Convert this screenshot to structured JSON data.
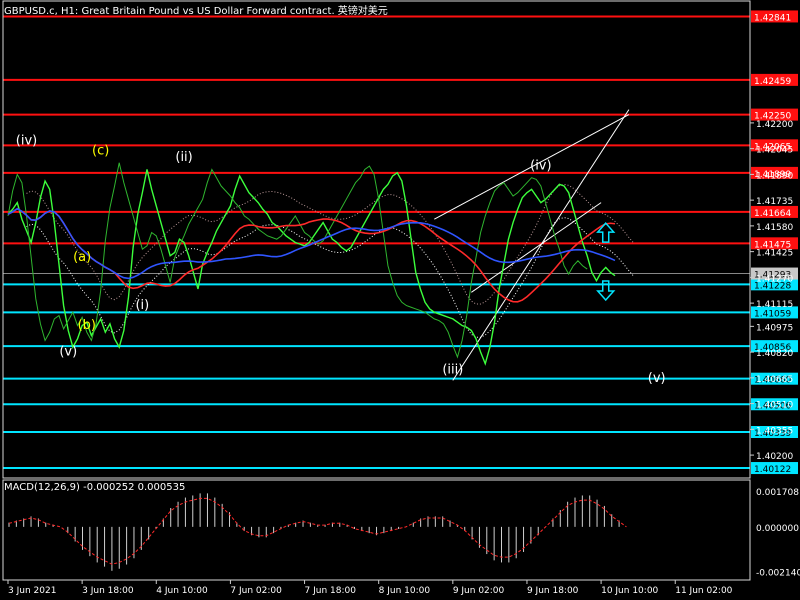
{
  "chart_data": {
    "type": "line",
    "title": "GBPUSD.c, H1:  Great Britain Pound vs US Dollar Forward contract. 英镑对美元",
    "instrument": "GBPUSD.c",
    "timeframe": "H1",
    "price_axis": {
      "min": 1.4005,
      "max": 1.4294,
      "tick_labels": [
        "1.42200",
        "1.42045",
        "1.41890",
        "1.41735",
        "1.41580",
        "1.41425",
        "1.41270",
        "1.41115",
        "1.40975",
        "1.40820",
        "1.40665",
        "1.40510",
        "1.40355",
        "1.40200"
      ],
      "tick_values": [
        1.422,
        1.42045,
        1.4189,
        1.41735,
        1.4158,
        1.41425,
        1.4127,
        1.41115,
        1.40975,
        1.4082,
        1.40665,
        1.4051,
        1.40355,
        1.402
      ]
    },
    "time_axis": {
      "labels": [
        "3 Jun 2021",
        "3 Jun 18:00",
        "4 Jun 10:00",
        "7 Jun 02:00",
        "7 Jun 18:00",
        "8 Jun 10:00",
        "9 Jun 02:00",
        "9 Jun 18:00",
        "10 Jun 10:00",
        "11 Jun 02:00"
      ],
      "index": [
        0,
        16,
        32,
        48,
        64,
        80,
        96,
        112,
        128,
        144
      ]
    },
    "close": [
      1.4165,
      1.4168,
      1.4172,
      1.4162,
      1.4155,
      1.4148,
      1.416,
      1.4175,
      1.4185,
      1.418,
      1.416,
      1.4135,
      1.411,
      1.4095,
      1.4085,
      1.409,
      1.4098,
      1.41,
      1.4092,
      1.4097,
      1.4102,
      1.4094,
      1.4099,
      1.409,
      1.4085,
      1.4095,
      1.4115,
      1.4145,
      1.4165,
      1.4178,
      1.4192,
      1.418,
      1.417,
      1.416,
      1.415,
      1.414,
      1.4142,
      1.415,
      1.4148,
      1.414,
      1.413,
      1.412,
      1.4135,
      1.4142,
      1.4148,
      1.4155,
      1.416,
      1.4165,
      1.417,
      1.418,
      1.4188,
      1.4183,
      1.4178,
      1.4175,
      1.4172,
      1.4168,
      1.4165,
      1.416,
      1.4158,
      1.4155,
      1.4152,
      1.415,
      1.4148,
      1.4147,
      1.4146,
      1.4148,
      1.4152,
      1.4156,
      1.416,
      1.4155,
      1.415,
      1.4148,
      1.4145,
      1.4143,
      1.4145,
      1.415,
      1.4155,
      1.416,
      1.4165,
      1.417,
      1.4175,
      1.418,
      1.4183,
      1.4188,
      1.419,
      1.4185,
      1.417,
      1.415,
      1.413,
      1.412,
      1.4112,
      1.4108,
      1.4106,
      1.4105,
      1.4104,
      1.4103,
      1.4102,
      1.41,
      1.4098,
      1.4097,
      1.4095,
      1.409,
      1.4082,
      1.4075,
      1.4085,
      1.41,
      1.412,
      1.4135,
      1.415,
      1.416,
      1.4168,
      1.4175,
      1.4178,
      1.418,
      1.4176,
      1.4172,
      1.4174,
      1.4177,
      1.418,
      1.4183,
      1.4182,
      1.4178,
      1.4168,
      1.4158,
      1.4148,
      1.414,
      1.413,
      1.4125,
      1.413,
      1.4133,
      1.413,
      1.4128
    ],
    "ichimoku_cloud": {
      "visible": true
    },
    "moving_averages": [
      {
        "color": "#ff2a2a"
      },
      {
        "color": "#2f55ff"
      }
    ],
    "horizontal_levels": [
      {
        "price": 1.42841,
        "label": "1.42841",
        "color": "#ff1010"
      },
      {
        "price": 1.42459,
        "label": "1.42459",
        "color": "#ff1010"
      },
      {
        "price": 1.4225,
        "label": "1.42250",
        "color": "#ff1010"
      },
      {
        "price": 1.42065,
        "label": "1.42065",
        "color": "#ff1010"
      },
      {
        "price": 1.41899,
        "label": "1.41899",
        "color": "#ff1010"
      },
      {
        "price": 1.41664,
        "label": "1.41664",
        "color": "#ff1010"
      },
      {
        "price": 1.41475,
        "label": "1.41475",
        "color": "#ff1010"
      },
      {
        "price": 1.41228,
        "label": "1.41228",
        "color": "#00e5ff"
      },
      {
        "price": 1.41059,
        "label": "1.41059",
        "color": "#00e5ff"
      },
      {
        "price": 1.40856,
        "label": "1.40856",
        "color": "#00e5ff"
      },
      {
        "price": 1.4066,
        "label": "1.40660",
        "color": "#00e5ff"
      },
      {
        "price": 1.40506,
        "label": "1.40506",
        "color": "#00e5ff"
      },
      {
        "price": 1.40339,
        "label": "1.40339",
        "color": "#00e5ff"
      },
      {
        "price": 1.40122,
        "label": "1.40122",
        "color": "#00e5ff"
      }
    ],
    "current_price": {
      "price": 1.41293,
      "label": "1.41293"
    },
    "wave_labels": [
      {
        "text": "(iv)",
        "index": 4,
        "price": 1.4207,
        "color": "#ffffff"
      },
      {
        "text": "(c)",
        "index": 20,
        "price": 1.4201,
        "color": "#ffff00"
      },
      {
        "text": "(ii)",
        "index": 38,
        "price": 1.4197,
        "color": "#ffffff"
      },
      {
        "text": "(iv)",
        "index": 115,
        "price": 1.4192,
        "color": "#ffffff"
      },
      {
        "text": "(a)",
        "index": 16,
        "price": 1.4137,
        "color": "#ffff00"
      },
      {
        "text": "(i)",
        "index": 29,
        "price": 1.4108,
        "color": "#ffffff"
      },
      {
        "text": "(b)",
        "index": 17,
        "price": 1.4096,
        "color": "#ffff00"
      },
      {
        "text": "(v)",
        "index": 13,
        "price": 1.408,
        "color": "#ffffff"
      },
      {
        "text": "(iii)",
        "index": 96,
        "price": 1.4069,
        "color": "#ffffff"
      },
      {
        "text": "(v)",
        "index": 140,
        "price": 1.4064,
        "color": "#ffffff"
      }
    ],
    "arrows": [
      {
        "direction": "up",
        "index": 129,
        "price": 1.4153,
        "color": "#00e5ff"
      },
      {
        "direction": "down",
        "index": 129,
        "price": 1.412,
        "color": "#00e5ff"
      }
    ],
    "macd": {
      "label": "MACD(12,26,9) -0.000252 0.000535",
      "tick_labels": [
        "0.001708",
        "0.000000",
        "-0.002140"
      ],
      "tick_values": [
        0.001708,
        0,
        -0.00214
      ],
      "min": -0.0023,
      "max": 0.002,
      "histogram": [
        0.0002,
        0.0003,
        0.0004,
        0.0005,
        0.0004,
        0.0002,
        0.0001,
        0.0,
        -0.0003,
        -0.0007,
        -0.0011,
        -0.0014,
        -0.0017,
        -0.0019,
        -0.0021,
        -0.002,
        -0.0018,
        -0.0015,
        -0.0011,
        -0.0006,
        -0.0001,
        0.0004,
        0.0009,
        0.0012,
        0.0014,
        0.0015,
        0.0016,
        0.0016,
        0.0014,
        0.0011,
        0.0007,
        0.0002,
        -0.0002,
        -0.0004,
        -0.0005,
        -0.0005,
        -0.0003,
        -0.0001,
        0.0001,
        0.0002,
        0.0003,
        0.0002,
        0.0001,
        0.0001,
        0.0002,
        0.0002,
        0.0001,
        -0.0001,
        -0.0002,
        -0.0003,
        -0.0004,
        -0.0003,
        -0.0002,
        -0.0001,
        0.0,
        0.0002,
        0.0004,
        0.0005,
        0.0005,
        0.0005,
        0.0003,
        0.0001,
        -0.0002,
        -0.0006,
        -0.001,
        -0.0013,
        -0.0016,
        -0.0017,
        -0.0017,
        -0.0015,
        -0.0012,
        -0.0008,
        -0.0004,
        0.0,
        0.0004,
        0.0008,
        0.0012,
        0.0014,
        0.0015,
        0.0015,
        0.0013,
        0.001,
        0.0006,
        0.0003,
        0.0
      ],
      "signal_color": "#ff2a2a"
    }
  }
}
